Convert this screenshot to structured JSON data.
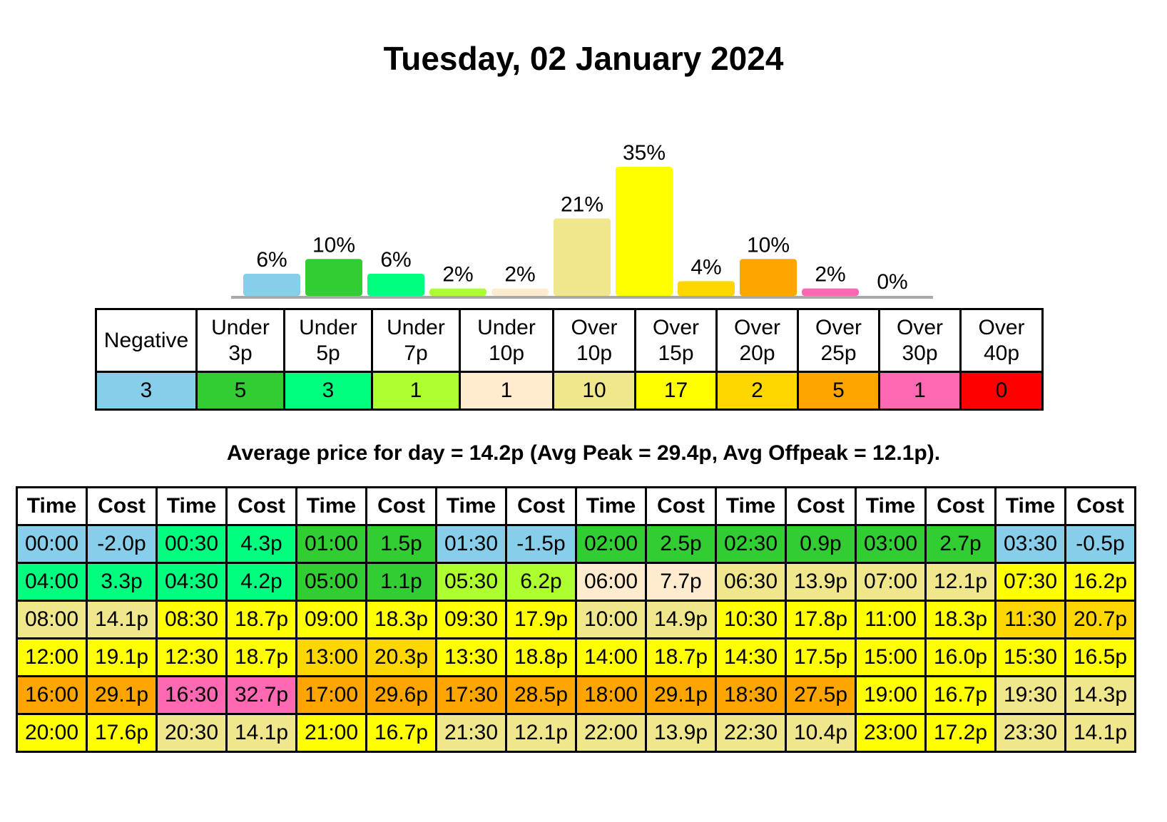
{
  "title": "Tuesday, 02 January 2024",
  "colors": {
    "negative": "#87CEEB",
    "under3": "#32CD32",
    "under5": "#00FF7F",
    "under7": "#ADFF2F",
    "under10": "#FFEBCD",
    "over10": "#F0E68C",
    "over15": "#FFFF00",
    "over20": "#FFD700",
    "over25": "#FFA500",
    "over30": "#FF69B4",
    "over40": "#FF0000",
    "axis": "#A9A9A9"
  },
  "chart_data": {
    "type": "bar",
    "title": "",
    "xlabel": "",
    "ylabel": "",
    "categories": [
      "Negative",
      "Under 3p",
      "Under 5p",
      "Under 7p",
      "Under 10p",
      "Over 10p",
      "Over 15p",
      "Over 20p",
      "Over 25p",
      "Over 30p",
      "Over 40p"
    ],
    "values": [
      6,
      10,
      6,
      2,
      2,
      21,
      35,
      4,
      10,
      2,
      0
    ],
    "labels": [
      "6%",
      "10%",
      "6%",
      "2%",
      "2%",
      "21%",
      "35%",
      "4%",
      "10%",
      "2%",
      "0%"
    ],
    "bar_colors": [
      "#87CEEB",
      "#32CD32",
      "#00FF7F",
      "#ADFF2F",
      "#FFEBCD",
      "#F0E68C",
      "#FFFF00",
      "#FFD700",
      "#FFA500",
      "#FF69B4",
      "#FF0000"
    ],
    "units": "percent of half-hour slots",
    "ylim": [
      0,
      35
    ],
    "grid": false,
    "legend": "none"
  },
  "summary": {
    "headers": [
      [
        "Negative"
      ],
      [
        "Under",
        "3p"
      ],
      [
        "Under",
        "5p"
      ],
      [
        "Under",
        "7p"
      ],
      [
        "Under",
        "10p"
      ],
      [
        "Over",
        "10p"
      ],
      [
        "Over",
        "15p"
      ],
      [
        "Over",
        "20p"
      ],
      [
        "Over",
        "25p"
      ],
      [
        "Over",
        "30p"
      ],
      [
        "Over",
        "40p"
      ]
    ],
    "counts": [
      "3",
      "5",
      "3",
      "1",
      "1",
      "10",
      "17",
      "2",
      "5",
      "1",
      "0"
    ],
    "colors": [
      "#87CEEB",
      "#32CD32",
      "#00FF7F",
      "#ADFF2F",
      "#FFEBCD",
      "#F0E68C",
      "#FFFF00",
      "#FFD700",
      "#FFA500",
      "#FF69B4",
      "#FF0000"
    ]
  },
  "average_text": "Average price for day = 14.2p (Avg Peak = 29.4p, Avg Offpeak = 12.1p).",
  "prices": {
    "time_header": "Time",
    "cost_header": "Cost",
    "rows": [
      [
        [
          "00:00",
          "-2.0p",
          "#87CEEB"
        ],
        [
          "00:30",
          "4.3p",
          "#00FF7F"
        ],
        [
          "01:00",
          "1.5p",
          "#32CD32"
        ],
        [
          "01:30",
          "-1.5p",
          "#87CEEB"
        ],
        [
          "02:00",
          "2.5p",
          "#32CD32"
        ],
        [
          "02:30",
          "0.9p",
          "#32CD32"
        ],
        [
          "03:00",
          "2.7p",
          "#32CD32"
        ],
        [
          "03:30",
          "-0.5p",
          "#87CEEB"
        ]
      ],
      [
        [
          "04:00",
          "3.3p",
          "#00FF7F"
        ],
        [
          "04:30",
          "4.2p",
          "#00FF7F"
        ],
        [
          "05:00",
          "1.1p",
          "#32CD32"
        ],
        [
          "05:30",
          "6.2p",
          "#ADFF2F"
        ],
        [
          "06:00",
          "7.7p",
          "#FFEBCD"
        ],
        [
          "06:30",
          "13.9p",
          "#F0E68C"
        ],
        [
          "07:00",
          "12.1p",
          "#F0E68C"
        ],
        [
          "07:30",
          "16.2p",
          "#FFFF00"
        ]
      ],
      [
        [
          "08:00",
          "14.1p",
          "#F0E68C"
        ],
        [
          "08:30",
          "18.7p",
          "#FFFF00"
        ],
        [
          "09:00",
          "18.3p",
          "#FFFF00"
        ],
        [
          "09:30",
          "17.9p",
          "#FFFF00"
        ],
        [
          "10:00",
          "14.9p",
          "#F0E68C"
        ],
        [
          "10:30",
          "17.8p",
          "#FFFF00"
        ],
        [
          "11:00",
          "18.3p",
          "#FFFF00"
        ],
        [
          "11:30",
          "20.7p",
          "#FFD700"
        ]
      ],
      [
        [
          "12:00",
          "19.1p",
          "#FFFF00"
        ],
        [
          "12:30",
          "18.7p",
          "#FFFF00"
        ],
        [
          "13:00",
          "20.3p",
          "#FFD700"
        ],
        [
          "13:30",
          "18.8p",
          "#FFFF00"
        ],
        [
          "14:00",
          "18.7p",
          "#FFFF00"
        ],
        [
          "14:30",
          "17.5p",
          "#FFFF00"
        ],
        [
          "15:00",
          "16.0p",
          "#FFFF00"
        ],
        [
          "15:30",
          "16.5p",
          "#FFFF00"
        ]
      ],
      [
        [
          "16:00",
          "29.1p",
          "#FFA500"
        ],
        [
          "16:30",
          "32.7p",
          "#FF69B4"
        ],
        [
          "17:00",
          "29.6p",
          "#FFA500"
        ],
        [
          "17:30",
          "28.5p",
          "#FFA500"
        ],
        [
          "18:00",
          "29.1p",
          "#FFA500"
        ],
        [
          "18:30",
          "27.5p",
          "#FFA500"
        ],
        [
          "19:00",
          "16.7p",
          "#FFFF00"
        ],
        [
          "19:30",
          "14.3p",
          "#F0E68C"
        ]
      ],
      [
        [
          "20:00",
          "17.6p",
          "#FFFF00"
        ],
        [
          "20:30",
          "14.1p",
          "#F0E68C"
        ],
        [
          "21:00",
          "16.7p",
          "#FFFF00"
        ],
        [
          "21:30",
          "12.1p",
          "#F0E68C"
        ],
        [
          "22:00",
          "13.9p",
          "#F0E68C"
        ],
        [
          "22:30",
          "10.4p",
          "#F0E68C"
        ],
        [
          "23:00",
          "17.2p",
          "#FFFF00"
        ],
        [
          "23:30",
          "14.1p",
          "#F0E68C"
        ]
      ]
    ]
  }
}
